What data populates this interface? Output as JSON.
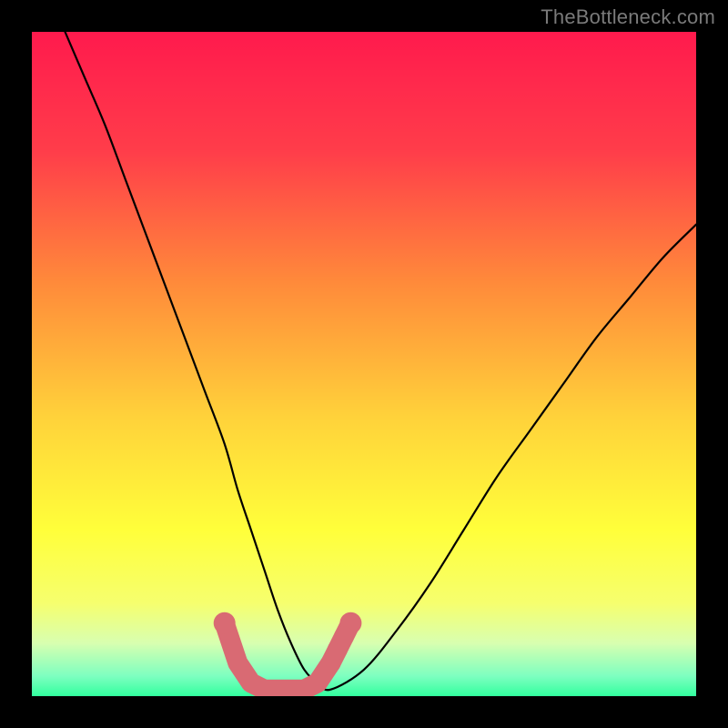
{
  "attribution": "TheBottleneck.com",
  "chart_data": {
    "type": "line",
    "title": "",
    "xlabel": "",
    "ylabel": "",
    "xlim": [
      0,
      100
    ],
    "ylim": [
      0,
      100
    ],
    "gradient_stops": [
      {
        "offset": 0.0,
        "color": "#ff1a4d"
      },
      {
        "offset": 0.18,
        "color": "#ff3d4a"
      },
      {
        "offset": 0.38,
        "color": "#ff8b3a"
      },
      {
        "offset": 0.58,
        "color": "#ffd23a"
      },
      {
        "offset": 0.75,
        "color": "#ffff3a"
      },
      {
        "offset": 0.86,
        "color": "#f6ff6e"
      },
      {
        "offset": 0.92,
        "color": "#d8ffb0"
      },
      {
        "offset": 0.97,
        "color": "#7dffc0"
      },
      {
        "offset": 1.0,
        "color": "#32ff9e"
      }
    ],
    "series": [
      {
        "name": "bottleneck-curve",
        "x": [
          5,
          8,
          11,
          14,
          17,
          20,
          23,
          26,
          29,
          31,
          33,
          35,
          37,
          39,
          41,
          43,
          45,
          50,
          55,
          60,
          65,
          70,
          75,
          80,
          85,
          90,
          95,
          100
        ],
        "y": [
          100,
          93,
          86,
          78,
          70,
          62,
          54,
          46,
          38,
          31,
          25,
          19,
          13,
          8,
          4,
          2,
          1,
          4,
          10,
          17,
          25,
          33,
          40,
          47,
          54,
          60,
          66,
          71
        ]
      }
    ],
    "markers": {
      "name": "highlight-region",
      "color": "#d96a73",
      "points": [
        {
          "x": 29,
          "y": 11
        },
        {
          "x": 30,
          "y": 8
        },
        {
          "x": 31,
          "y": 5
        },
        {
          "x": 33,
          "y": 2
        },
        {
          "x": 35,
          "y": 1
        },
        {
          "x": 37,
          "y": 1
        },
        {
          "x": 39,
          "y": 1
        },
        {
          "x": 41,
          "y": 1
        },
        {
          "x": 43,
          "y": 2
        },
        {
          "x": 45,
          "y": 5
        },
        {
          "x": 46,
          "y": 7
        },
        {
          "x": 47,
          "y": 9
        },
        {
          "x": 48,
          "y": 11
        }
      ]
    }
  }
}
